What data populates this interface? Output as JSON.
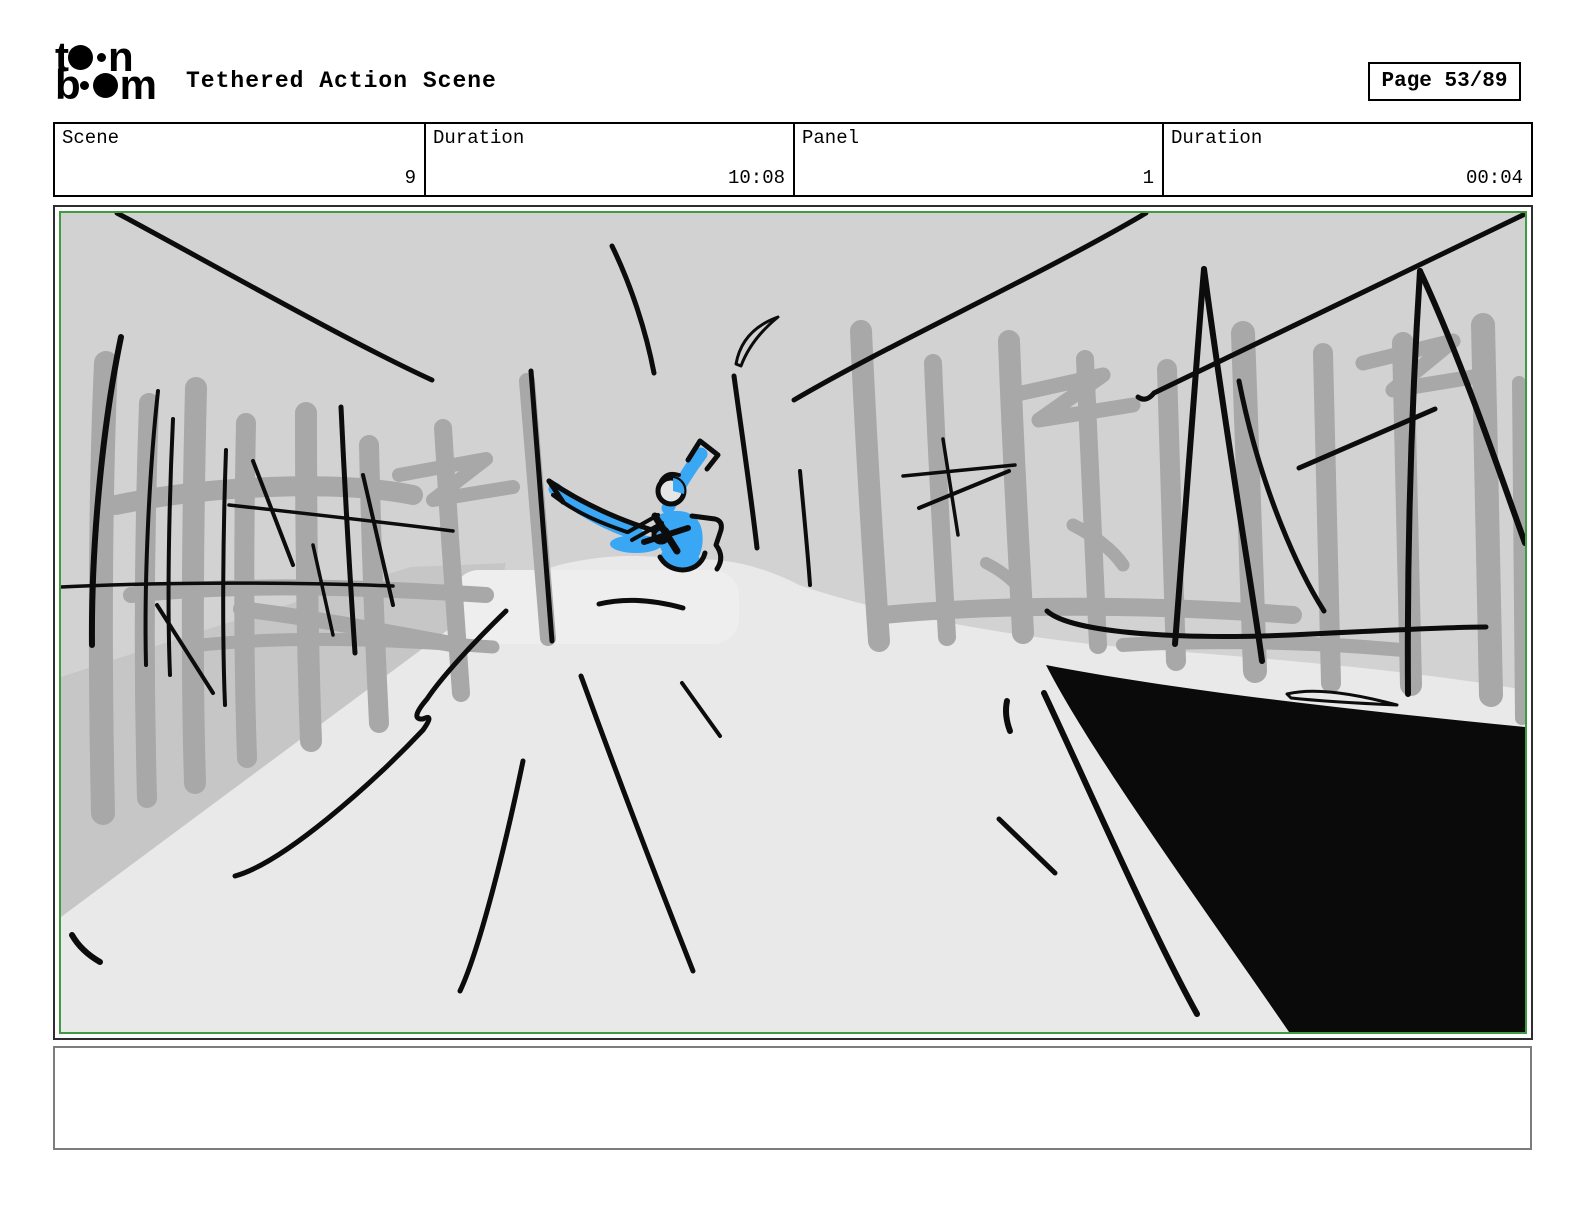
{
  "header": {
    "title": "Tethered Action Scene",
    "page_label": "Page 53/89",
    "logo": {
      "row1_first": "t",
      "row1_last": "n",
      "row2_first": "b",
      "row2_last": "m"
    }
  },
  "meta_fields": [
    {
      "label": "Scene",
      "value": "9"
    },
    {
      "label": "Duration",
      "value": "10:08"
    },
    {
      "label": "Panel",
      "value": "1"
    },
    {
      "label": "Duration",
      "value": "00:04"
    }
  ],
  "caption": {
    "text": ""
  },
  "colors": {
    "accent_green": "#3f9b40",
    "figure_blue": "#3aa7f4",
    "sketch_bg": "#d2d2d2",
    "trunk_gray": "#a8a8a8",
    "embankment_gray": "#c6c6c6",
    "road_gray": "#e9e9e9",
    "ink_black": "#0c0c0c",
    "caption_border": "#7d7d7d"
  }
}
